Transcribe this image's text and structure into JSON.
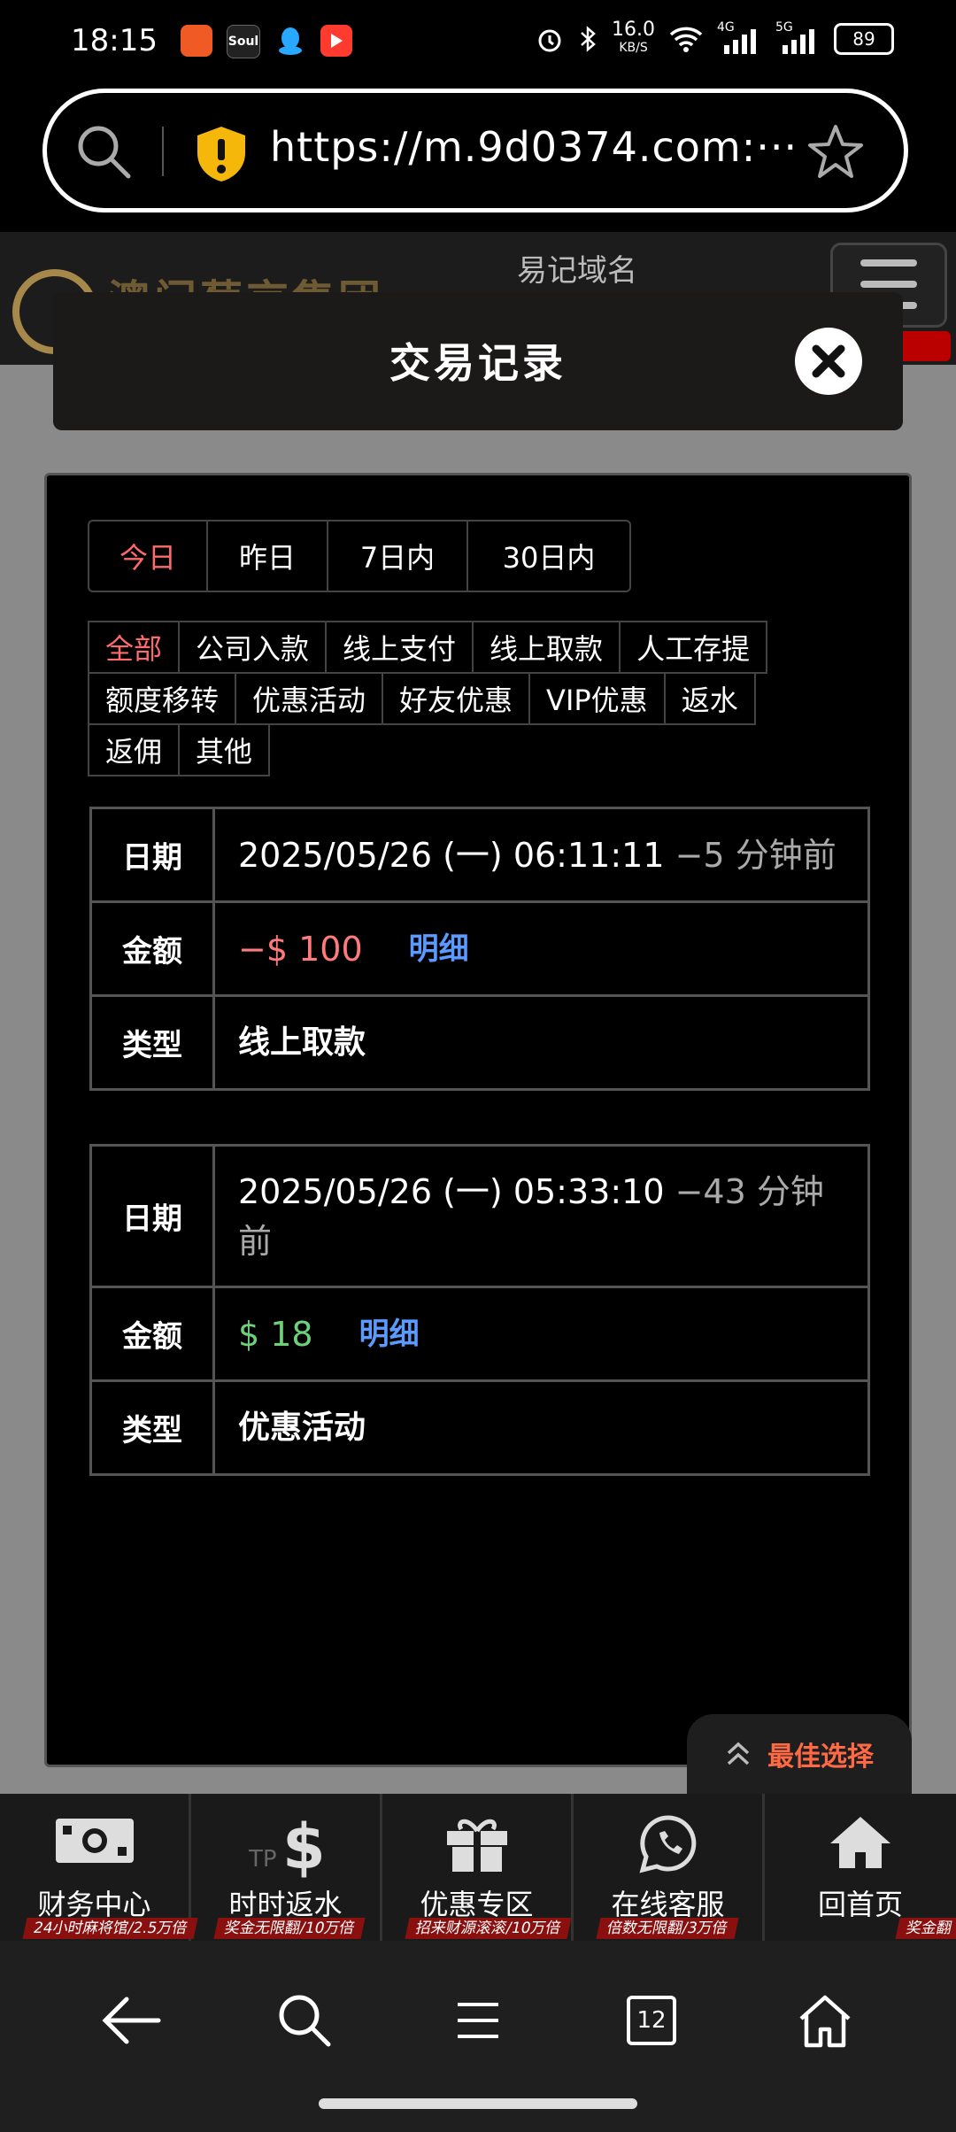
{
  "status_bar": {
    "time": "18:15",
    "net_speed": "16.0",
    "net_unit": "KB/S",
    "signal_1": "4G",
    "signal_2": "5G",
    "battery": "89",
    "apps": [
      "Soul"
    ]
  },
  "browser": {
    "url": "https://m.9d0374.com:···"
  },
  "site": {
    "logo_text": "澳门葡京集团",
    "domain_label": "易记域名"
  },
  "modal": {
    "title": "交易记录",
    "date_tabs": [
      "今日",
      "昨日",
      "7日内",
      "30日内"
    ],
    "categories_row1": [
      "全部",
      "公司入款",
      "线上支付",
      "线上取款",
      "人工存提"
    ],
    "categories_row2": [
      "额度移转",
      "优惠活动",
      "好友优惠",
      "VIP优惠",
      "返水"
    ],
    "categories_row3": [
      "返佣",
      "其他"
    ],
    "labels": {
      "date": "日期",
      "amount": "金额",
      "type": "类型",
      "detail": "明细"
    },
    "records": [
      {
        "date": "2025/05/26 (一) 06:11:11",
        "ago": "−5 分钟前",
        "amount": "−$ 100",
        "type": "线上取款"
      },
      {
        "date": "2025/05/26 (一) 05:33:10",
        "ago": "−43 分钟前",
        "amount": "$ 18",
        "type": "优惠活动"
      }
    ],
    "best_choice": "最佳选择"
  },
  "site_nav": [
    {
      "label": "财务中心",
      "promo": "24小时麻将馆/2.5万倍",
      "icon": "cash-icon"
    },
    {
      "label": "时时返水",
      "promo": "奖金无限翻/10万倍",
      "icon": "dollar-icon"
    },
    {
      "label": "优惠专区",
      "promo": "招来财源滚滚/10万倍",
      "icon": "gift-icon"
    },
    {
      "label": "在线客服",
      "promo": "倍数无限翻/3万倍",
      "icon": "whatsapp-icon"
    },
    {
      "label": "回首页",
      "promo": "奖金翻",
      "icon": "home-icon"
    }
  ],
  "system_nav": {
    "tabs_count": "12"
  },
  "colors": {
    "active": "#ff6b6b",
    "negative": "#ff7b7b",
    "positive": "#6fd07a",
    "link": "#5b9bff"
  }
}
